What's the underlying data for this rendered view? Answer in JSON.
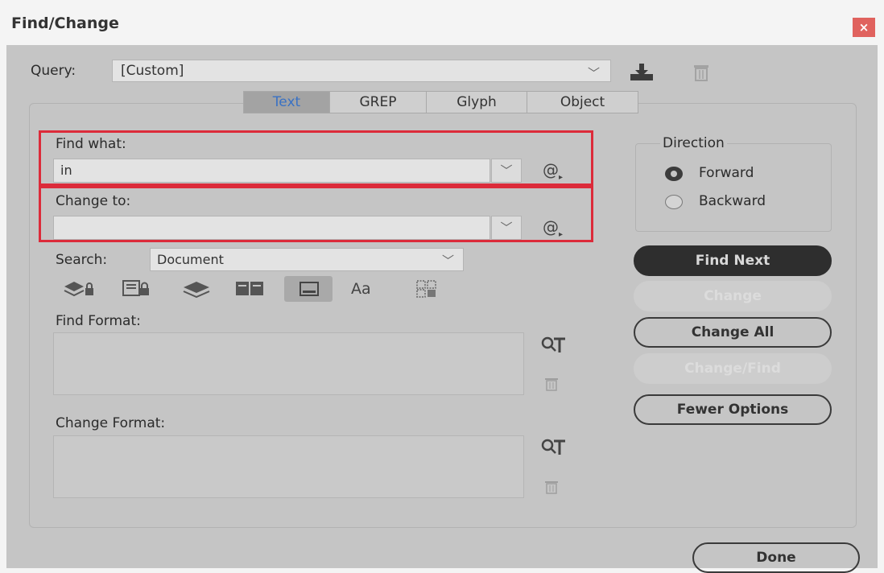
{
  "window": {
    "title": "Find/Change",
    "close_glyph": "×"
  },
  "query": {
    "label": "Query:",
    "value": "[Custom]"
  },
  "tabs": [
    {
      "label": "Text",
      "active": true
    },
    {
      "label": "GREP",
      "active": false
    },
    {
      "label": "Glyph",
      "active": false
    },
    {
      "label": "Object",
      "active": false
    }
  ],
  "find": {
    "label": "Find what:",
    "value": "in"
  },
  "change": {
    "label": "Change to:",
    "value": ""
  },
  "direction": {
    "label": "Direction",
    "options": [
      {
        "label": "Forward",
        "selected": true
      },
      {
        "label": "Backward",
        "selected": false
      }
    ]
  },
  "search": {
    "label": "Search:",
    "value": "Document"
  },
  "options_icons": [
    "locked-layers-icon",
    "locked-stories-icon",
    "hidden-layers-icon",
    "master-pages-icon",
    "footnotes-icon",
    "case-sensitive-icon",
    "whole-word-icon"
  ],
  "case_sensitive_glyph": "Aa",
  "find_format": {
    "label": "Find Format:"
  },
  "change_format": {
    "label": "Change Format:"
  },
  "buttons": {
    "find_next": "Find Next",
    "change": "Change",
    "change_all": "Change All",
    "change_find": "Change/Find",
    "fewer_options": "Fewer Options",
    "done": "Done"
  },
  "colors": {
    "highlight_border": "#dc2b3a",
    "active_tab_text": "#3a72c4",
    "primary_button": "#2e2e2e",
    "close_button": "#e0625e"
  }
}
